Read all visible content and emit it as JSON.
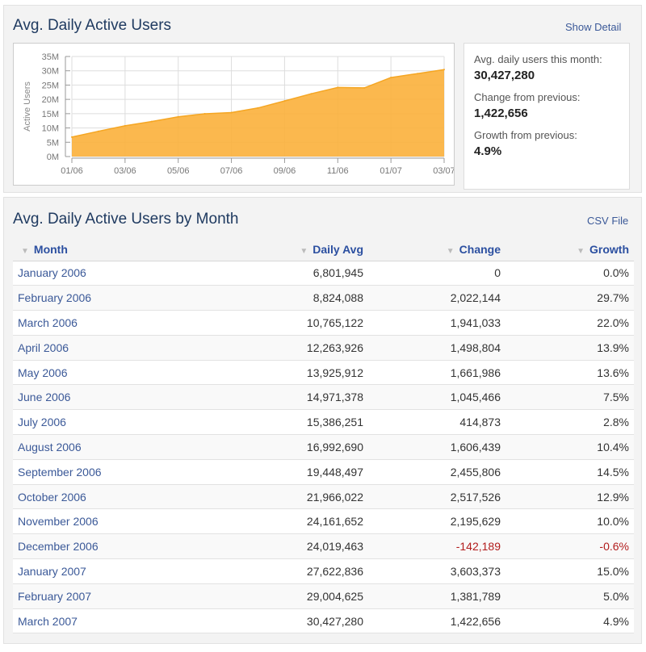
{
  "summary_panel": {
    "title": "Avg. Daily Active Users",
    "detail_link": "Show Detail",
    "stats": [
      {
        "label": "Avg. daily users this month:",
        "value": "30,427,280"
      },
      {
        "label": "Change from previous:",
        "value": "1,422,656"
      },
      {
        "label": "Growth from previous:",
        "value": "4.9%"
      }
    ]
  },
  "chart_data": {
    "type": "area",
    "title": "",
    "xlabel": "",
    "ylabel": "Active Users",
    "y_ticks": [
      "0M",
      "5M",
      "10M",
      "15M",
      "20M",
      "25M",
      "30M",
      "35M"
    ],
    "ylim": [
      0,
      35000000
    ],
    "x_ticks": [
      "01/06",
      "03/06",
      "05/06",
      "07/06",
      "09/06",
      "11/06",
      "01/07",
      "03/07"
    ],
    "x": [
      "01/06",
      "02/06",
      "03/06",
      "04/06",
      "05/06",
      "06/06",
      "07/06",
      "08/06",
      "09/06",
      "10/06",
      "11/06",
      "12/06",
      "01/07",
      "02/07",
      "03/07"
    ],
    "values": [
      6801945,
      8824088,
      10765122,
      12263926,
      13925912,
      14971378,
      15386251,
      16992690,
      19448497,
      21966022,
      24161652,
      24019463,
      27622836,
      29004625,
      30427280
    ],
    "fill_color": "#fbb03b",
    "line_color": "#f5a623",
    "grid": true
  },
  "table_panel": {
    "title": "Avg. Daily Active Users by Month",
    "csv_link": "CSV File",
    "columns": [
      "Month",
      "Daily Avg",
      "Change",
      "Growth"
    ],
    "rows": [
      [
        "January 2006",
        "6,801,945",
        "0",
        "0.0%"
      ],
      [
        "February 2006",
        "8,824,088",
        "2,022,144",
        "29.7%"
      ],
      [
        "March 2006",
        "10,765,122",
        "1,941,033",
        "22.0%"
      ],
      [
        "April 2006",
        "12,263,926",
        "1,498,804",
        "13.9%"
      ],
      [
        "May 2006",
        "13,925,912",
        "1,661,986",
        "13.6%"
      ],
      [
        "June 2006",
        "14,971,378",
        "1,045,466",
        "7.5%"
      ],
      [
        "July 2006",
        "15,386,251",
        "414,873",
        "2.8%"
      ],
      [
        "August 2006",
        "16,992,690",
        "1,606,439",
        "10.4%"
      ],
      [
        "September 2006",
        "19,448,497",
        "2,455,806",
        "14.5%"
      ],
      [
        "October 2006",
        "21,966,022",
        "2,517,526",
        "12.9%"
      ],
      [
        "November 2006",
        "24,161,652",
        "2,195,629",
        "10.0%"
      ],
      [
        "December 2006",
        "24,019,463",
        "-142,189",
        "-0.6%"
      ],
      [
        "January 2007",
        "27,622,836",
        "3,603,373",
        "15.0%"
      ],
      [
        "February 2007",
        "29,004,625",
        "1,381,789",
        "5.0%"
      ],
      [
        "March 2007",
        "30,427,280",
        "1,422,656",
        "4.9%"
      ]
    ],
    "negative_color": "#b21c1c"
  }
}
